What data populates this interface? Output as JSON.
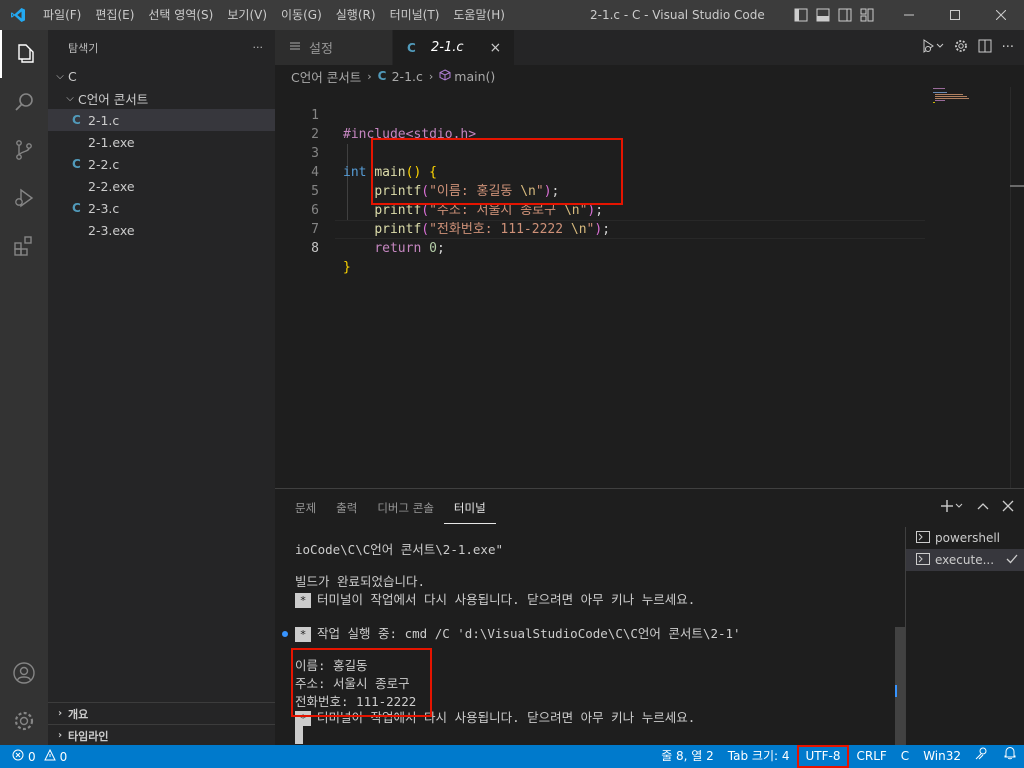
{
  "titlebar": {
    "menu": [
      "파일(F)",
      "편집(E)",
      "선택 영역(S)",
      "보기(V)",
      "이동(G)",
      "실행(R)",
      "터미널(T)",
      "도움말(H)"
    ],
    "title": "2-1.c - C - Visual Studio Code"
  },
  "sidebar": {
    "header": "탐색기",
    "more": "···",
    "root": "C",
    "folder": "C언어 콘서트",
    "files": [
      {
        "name": "2-1.c",
        "kind": "c"
      },
      {
        "name": "2-1.exe",
        "kind": "exe"
      },
      {
        "name": "2-2.c",
        "kind": "c"
      },
      {
        "name": "2-2.exe",
        "kind": "exe"
      },
      {
        "name": "2-3.c",
        "kind": "c"
      },
      {
        "name": "2-3.exe",
        "kind": "exe"
      }
    ],
    "outline": "개요",
    "timeline": "타임라인"
  },
  "tabs": [
    {
      "label": "설정",
      "icon": "settings-icon"
    },
    {
      "label": "2-1.c",
      "icon": "c-file-icon",
      "close": "×"
    }
  ],
  "breadcrumb": {
    "folder": "C언어 콘서트",
    "file": "2-1.c",
    "symbol": "main()"
  },
  "code": {
    "line_numbers": [
      "1",
      "2",
      "3",
      "4",
      "5",
      "6",
      "7",
      "8"
    ],
    "include": "#include<stdio.h>",
    "kw_int": "int",
    "fn_main": "main",
    "printf": "printf",
    "str1": "\"이름: 홍길동 ",
    "str2": "\"주소: 서울시 종로구 ",
    "str3": "\"전화번호: 111-2222 ",
    "esc": "\\n",
    "quote": "\"",
    "kw_return": "return",
    "zero": "0",
    "current_line": 8
  },
  "panel": {
    "tabs": [
      "문제",
      "출력",
      "디버그 콘솔",
      "터미널"
    ],
    "active_tab": "터미널",
    "terminal": {
      "line1": "ioCode\\C\\C언어 콘서트\\2-1.exe\"",
      "line2": "빌드가 완료되었습니다.",
      "line3": "터미널이 작업에서 다시 사용됩니다. 닫으려면 아무 키나 누르세요.",
      "line4": "작업 실행 중: cmd /C 'd:\\VisualStudioCode\\C\\C언어 콘서트\\2-1'",
      "out1": "이름: 홍길동",
      "out2": "주소: 서울시 종로구",
      "out3": "전화번호: 111-2222",
      "line8": "터미널이 작업에서 다시 사용됩니다. 닫으려면 아무 키나 누르세요.",
      "star": "*"
    },
    "terminals": [
      {
        "label": "powershell"
      },
      {
        "label": "execute...",
        "selected": true
      }
    ]
  },
  "statusbar": {
    "errors": "0",
    "warnings": "0",
    "position": "줄 8, 열 2",
    "tab_size": "Tab 크기: 4",
    "encoding": "UTF-8",
    "eol": "CRLF",
    "language": "C",
    "platform": "Win32"
  },
  "colors": {
    "accent": "#007acc",
    "highlight_box": "#e51400"
  }
}
